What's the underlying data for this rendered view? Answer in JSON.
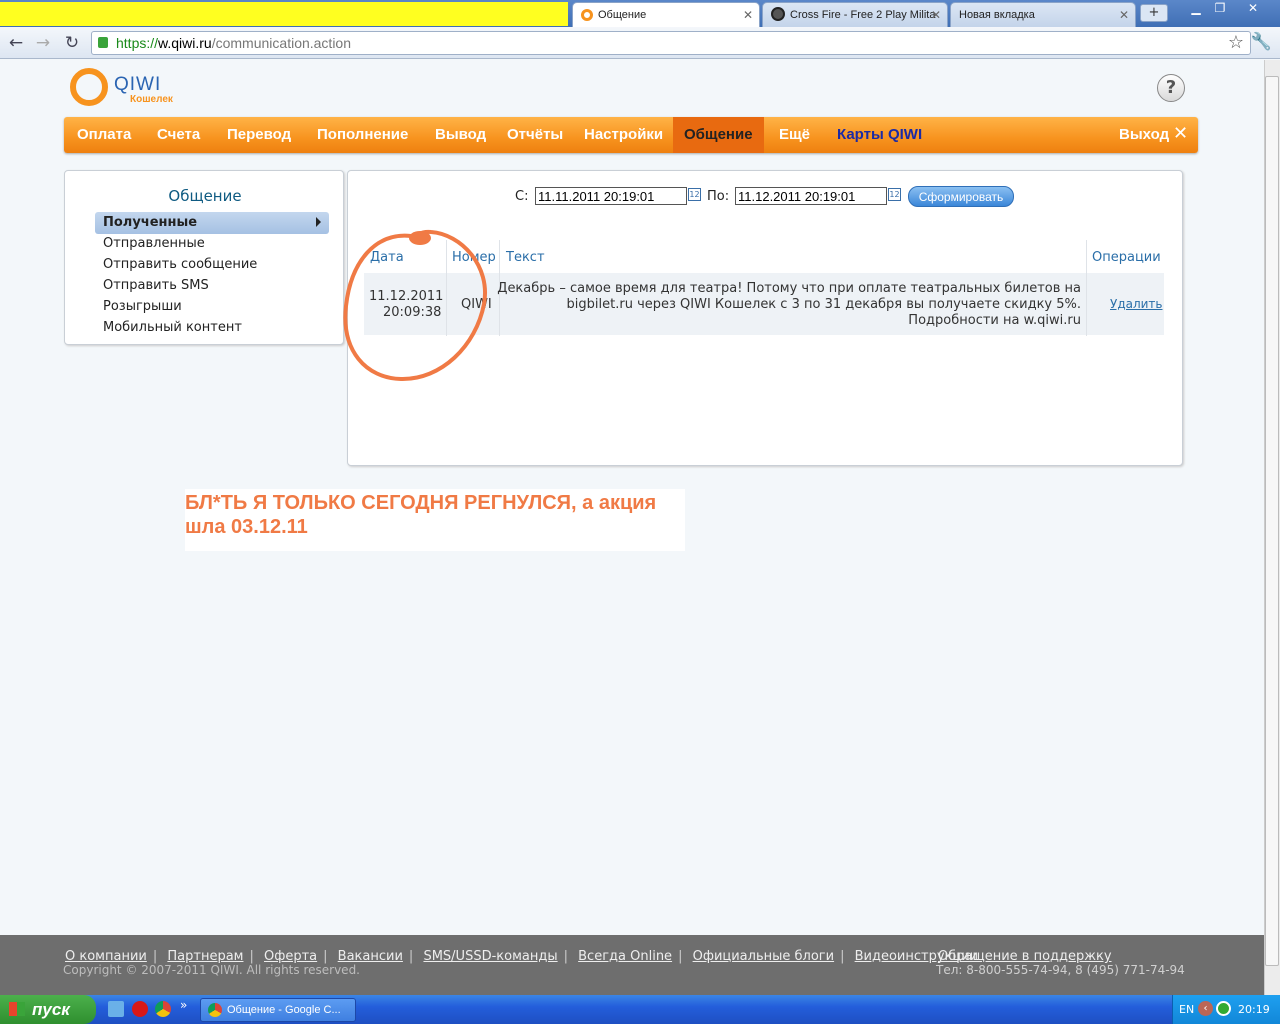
{
  "browser": {
    "tabs": [
      {
        "title": "Общение",
        "active": true
      },
      {
        "title": "Cross Fire - Free 2 Play Milita",
        "active": false
      },
      {
        "title": "Новая вкладка",
        "active": false
      }
    ],
    "url_scheme": "https://",
    "url_host": "w.qiwi.ru",
    "url_path": "/communication.action"
  },
  "site": {
    "logo_word": "QIWI",
    "logo_sub": "Кошелек",
    "help_label": "?"
  },
  "menu": {
    "items": [
      {
        "label": "Оплата"
      },
      {
        "label": "Счета"
      },
      {
        "label": "Перевод"
      },
      {
        "label": "Пополнение"
      },
      {
        "label": "Вывод"
      },
      {
        "label": "Отчёты"
      },
      {
        "label": "Настройки"
      },
      {
        "label": "Общение"
      },
      {
        "label": "Ещё"
      },
      {
        "label": "Карты QIWI"
      }
    ],
    "active": "Общение",
    "logout": "Выход"
  },
  "sidebar": {
    "title": "Общение",
    "items": [
      {
        "label": "Полученные"
      },
      {
        "label": "Отправленные"
      },
      {
        "label": "Отправить сообщение"
      },
      {
        "label": "Отправить SMS"
      },
      {
        "label": "Розыгрыши"
      },
      {
        "label": "Мобильный контент"
      }
    ]
  },
  "filter": {
    "from_label": "С:",
    "from_value": "11.11.2011 20:19:01",
    "to_label": "По:",
    "to_value": "11.12.2011 20:19:01",
    "calendar_icon_text": "12",
    "submit": "Сформировать"
  },
  "table": {
    "headers": [
      "Дата",
      "Номер",
      "Текст",
      "Операции"
    ],
    "rows": [
      {
        "date": "11.12.2011",
        "time": "20:09:38",
        "number": "QIWI",
        "text_line1": "Декабрь – самое время для театра! Потому что при оплате театральных билетов на",
        "text_line2": "bigbilet.ru через QIWI Кошелек с 3 по 31 декабря вы получаете скидку 5%.",
        "text_line3": "Подробности на w.qiwi.ru",
        "action": "Удалить"
      }
    ]
  },
  "annotation": {
    "line1": "БЛ*ТЬ Я ТОЛЬКО СЕГОДНЯ РЕГНУЛСЯ, а акция",
    "line2": "шла 03.12.11",
    "color": "#f07a45"
  },
  "footer": {
    "links": [
      "О компании",
      "Партнерам",
      "Оферта",
      "Вакансии",
      "SMS/USSD-команды",
      "Всегда Online",
      "Официальные блоги",
      "Видеоинструкции"
    ],
    "support": "Обращение в поддержку",
    "copyright": "Copyright © 2007-2011 QIWI. All rights reserved.",
    "phones": "Тел: 8-800-555-74-94, 8 (495) 771-74-94"
  },
  "taskbar": {
    "start": "пуск",
    "window": "Общение - Google C...",
    "lang": "EN",
    "clock": "20:19"
  },
  "colors": {
    "menu_orange": "#f7931e",
    "link_blue": "#2a6ea8"
  }
}
